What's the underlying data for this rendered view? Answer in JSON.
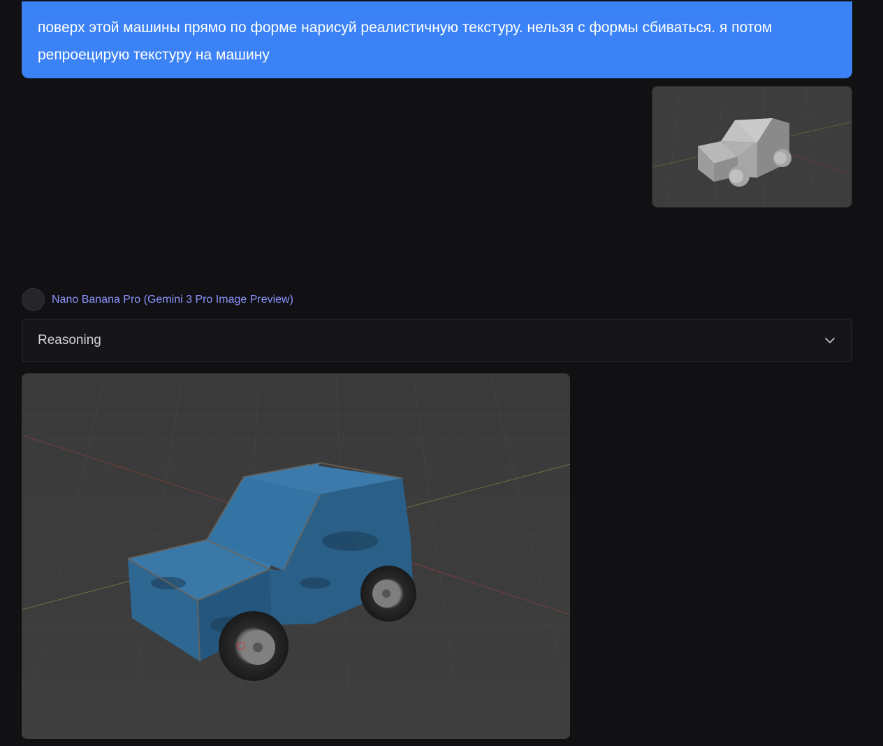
{
  "user_message": {
    "text": "поверх этой машины прямо по форме нарисуй реалистичную текстуру. нельзя с формы сбиваться. я потом репроецирую текстуру на машину",
    "attachment_icon": "grey-box-car-3d-render-icon"
  },
  "assistant": {
    "model_name": "Nano Banana Pro (Gemini 3 Pro Image Preview)",
    "reasoning_label": "Reasoning",
    "reasoning_icon": "chevron-down-icon",
    "result_icon": "blue-textured-car-render-icon"
  },
  "colors": {
    "background": "#111113",
    "user_bubble": "#3b82f6",
    "model_name": "#8b93ff",
    "car_paint": "#2f6d9c"
  }
}
